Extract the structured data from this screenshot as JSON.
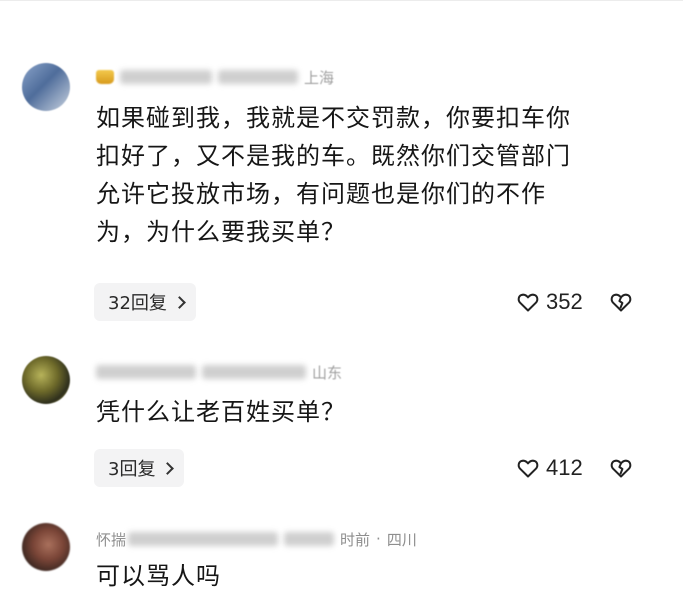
{
  "comments": [
    {
      "location": "上海",
      "text": "如果碰到我，我就是不交罚款，你要扣车你\n扣好了，又不是我的车。既然你们交管部门\n允许它投放市场，有问题也是你们的不作\n为，为什么要我买单？",
      "reply_label": "32回复",
      "likes": "352"
    },
    {
      "location": "山东",
      "text": "凭什么让老百姓买单？",
      "reply_label": "3回复",
      "likes": "412"
    },
    {
      "name_prefix": "怀揣",
      "time_suffix": "时前",
      "location": "四川",
      "text": "可以骂人吗"
    }
  ],
  "icons": {
    "like": "heart-icon",
    "dislike": "heartbreak-icon"
  },
  "colors": {
    "text": "#161616",
    "meta": "#9a9a9a",
    "reply_bg": "#f3f3f4"
  }
}
